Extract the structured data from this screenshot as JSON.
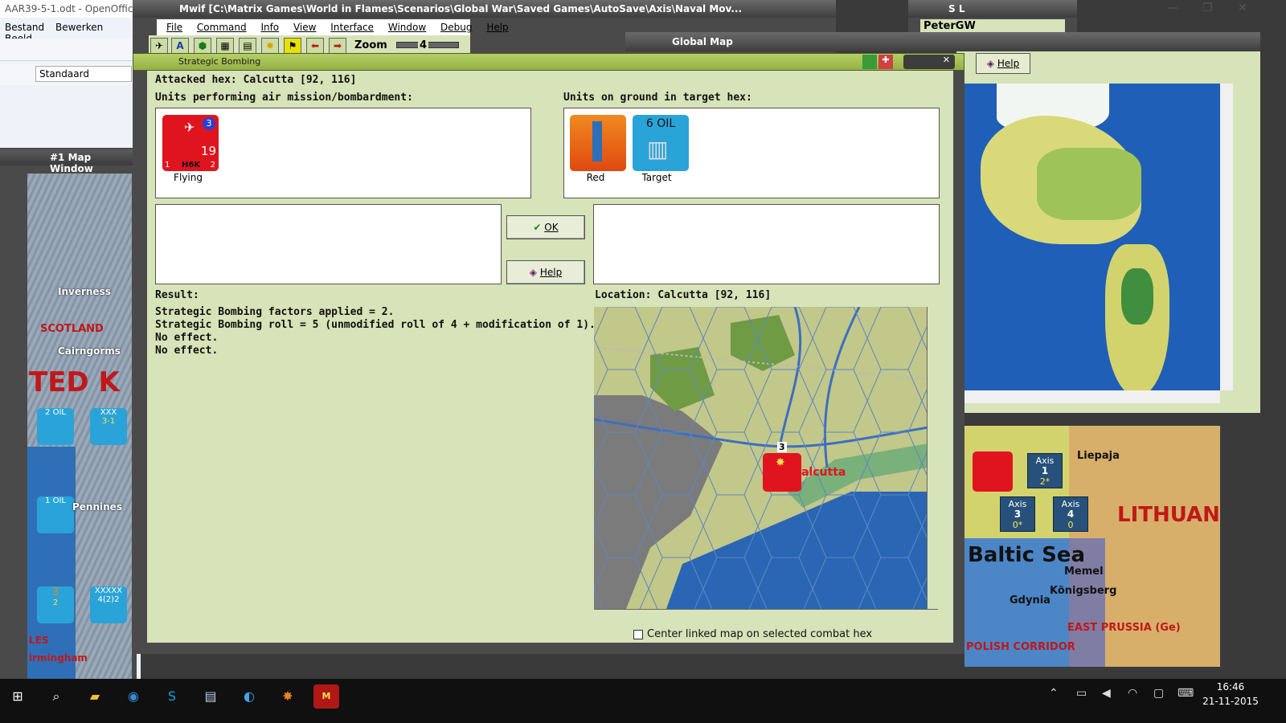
{
  "openoffice": {
    "title": "AAR39-5-1.odt - OpenOffic",
    "menu": [
      "Bestand",
      "Bewerken",
      "Beeld"
    ],
    "style_value": "Standaard"
  },
  "map_window": {
    "title": "#1 Map Window",
    "labels": {
      "inverness": "Inverness",
      "scotland": "SCOTLAND",
      "cairngorms": "Cairngorms",
      "kingdom": "TED K",
      "pennines": "Pennines",
      "birmingham": "irmingham",
      "les": "LES"
    },
    "units": [
      {
        "top": "2 OIL",
        "bottom": ""
      },
      {
        "top": "XXX",
        "bottom": "3-1"
      },
      {
        "top": "1 OIL",
        "bottom": ""
      },
      {
        "top": "3",
        "bottom": "2"
      },
      {
        "top": "XXXXX",
        "bottom": "4(2)2"
      }
    ]
  },
  "mwif": {
    "title": "Mwif [C:\\Matrix Games\\World in Flames\\Scenarios\\Global War\\Saved Games\\AutoSave\\Axis\\Naval Mov...",
    "menu": [
      "File",
      "Command",
      "Info",
      "View",
      "Interface",
      "Window",
      "Debug",
      "Help"
    ],
    "zoom_label": "Zoom",
    "zoom_value": "4"
  },
  "sl_window": {
    "title": "S L",
    "player": "PeterGW"
  },
  "global_map": {
    "title": "Global Map",
    "help_label": "Help"
  },
  "baltic_map": {
    "labels": {
      "baltic": "Baltic Sea",
      "lithuania": "LITHUAN",
      "liepaja": "Liepaja",
      "memel": "Memel",
      "konigsberg": "Königsberg",
      "gdynia": "Gdynia",
      "eastprussia": "EAST PRUSSIA (Ge)",
      "polish": "POLISH CORRIDOR"
    },
    "axis_boxes": [
      {
        "title": "Axis",
        "num": "1",
        "sub": "2*"
      },
      {
        "title": "Axis",
        "num": "3",
        "sub": "0*"
      },
      {
        "title": "Axis",
        "num": "4",
        "sub": "0"
      }
    ]
  },
  "dialog": {
    "title": "Strategic Bombing",
    "attacked_hex": "Attacked hex: Calcutta [92, 116]",
    "units_air_label": "Units performing air mission/bombardment:",
    "units_ground_label": "Units on ground in target hex:",
    "air_unit": {
      "caption": "Flying",
      "range": "3",
      "strength": "19",
      "name": "H6K",
      "left": "1",
      "right": "2"
    },
    "ground_units": [
      {
        "caption": "Red",
        "kind": "factory"
      },
      {
        "caption": "Target",
        "kind": "oil",
        "label": "6 OIL"
      }
    ],
    "ok_label": "OK",
    "help_label": "Help",
    "result_label": "Result:",
    "result_lines": [
      "Strategic Bombing factors applied = 2.",
      "Strategic Bombing roll = 5 (unmodified roll of 4 + modification of 1).",
      "No effect.",
      "No effect."
    ],
    "location": "Location:  Calcutta  [92, 116]",
    "map_city": "alcutta",
    "map_unit_stack": "3",
    "center_checkbox_label": "Center linked map on selected combat hex",
    "center_checked": false
  },
  "taskbar": {
    "time": "16:46",
    "date": "21-11-2015"
  }
}
